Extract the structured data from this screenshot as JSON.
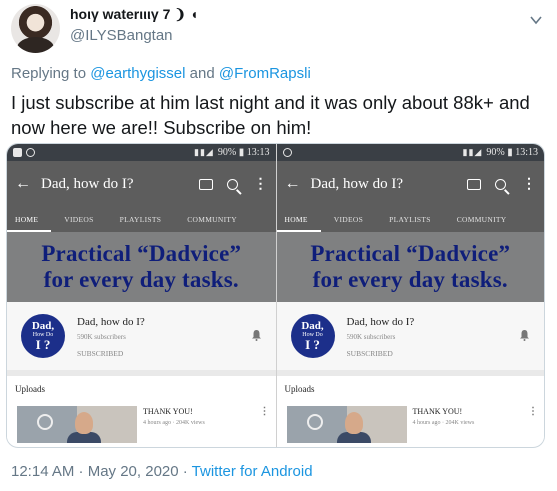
{
  "tweet": {
    "display_name": "hoιγ waterιιιγ 7 ❩ ◖",
    "username": "@ILYSBangtan",
    "reply_prefix": "Replying to ",
    "reply_mention_1": "@earthygissel",
    "reply_and": " and ",
    "reply_mention_2": "@FromRapsli",
    "text": "I just subscribe at him last night and it was only about 88k+ and now here we are!!  Subscribe on him!",
    "time": "12:14 AM · May 20, 2020 · ",
    "source": "Twitter for Android",
    "accent_color": "#1b95e0"
  },
  "screenshots": [
    {
      "status": {
        "battery": "90%",
        "time": "13:13"
      },
      "app_title": "Dad, how do I?",
      "tabs": [
        "HOME",
        "VIDEOS",
        "PLAYLISTS",
        "COMMUNITY"
      ],
      "banner_line_1": "Practical “Dadvice”",
      "banner_line_2": "for every day tasks.",
      "logo": {
        "l1": "Dad,",
        "l2": "How Do",
        "l3": "I ?"
      },
      "channel_name": "Dad, how do I?",
      "subscribers": "590K subscribers",
      "subscribed": "SUBSCRIBED",
      "uploads_label": "Uploads",
      "video_title": "THANK YOU!",
      "video_meta": "4 hours ago · 204K views"
    },
    {
      "status": {
        "battery": "90%",
        "time": "13:13"
      },
      "app_title": "Dad, how do I?",
      "tabs": [
        "HOME",
        "VIDEOS",
        "PLAYLISTS",
        "COMMUNITY"
      ],
      "banner_line_1": "Practical “Dadvice”",
      "banner_line_2": "for every day tasks.",
      "logo": {
        "l1": "Dad,",
        "l2": "How Do",
        "l3": "I ?"
      },
      "channel_name": "Dad, how do I?",
      "subscribers": "590K subscribers",
      "subscribed": "SUBSCRIBED",
      "uploads_label": "Uploads",
      "video_title": "THANK YOU!",
      "video_meta": "4 hours ago · 204K views"
    }
  ]
}
